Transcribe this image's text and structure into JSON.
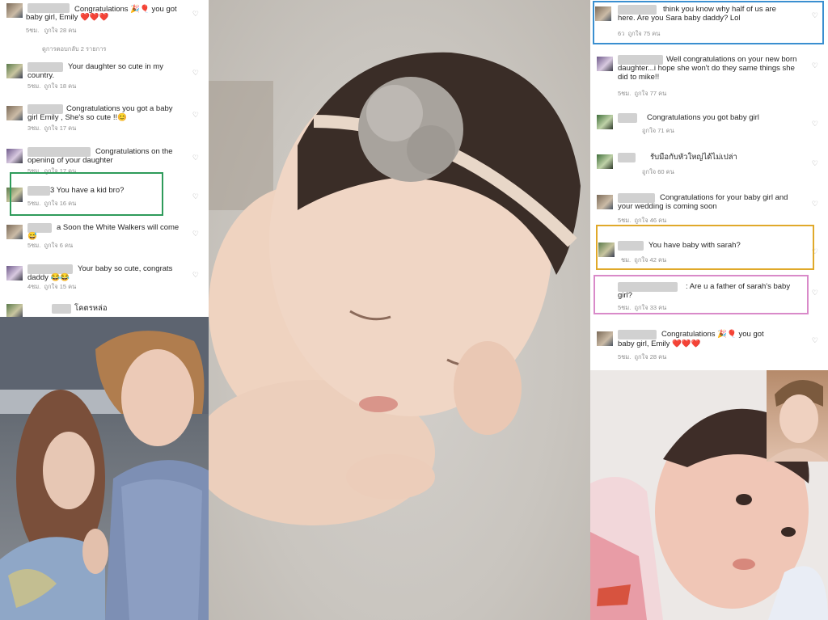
{
  "left_comments": {
    "top_text": "Congratulations",
    "top_emoji": "🎉🎈",
    "top_rest": "you got",
    "top_line2": "baby girl, Emily",
    "top_hearts": "❤️❤️❤️",
    "top_meta_time": "5ชม.",
    "top_meta_likes": "ถูกใจ 28 คน",
    "view_replies": "ดูการตอบกลับ 2 รายการ",
    "items": [
      {
        "text": "Your daughter so cute in my country.",
        "time": "5ชม.",
        "likes": "ถูกใจ 18 คน"
      },
      {
        "text": "Congratulations you got a baby girl Emily , She's so cute !!😊",
        "time": "3ชม.",
        "likes": "ถูกใจ 17 คน"
      },
      {
        "text": "Congratulations on the opening of your daughter",
        "time": "5ชม.",
        "likes": "ถูกใจ 17 คน"
      },
      {
        "text": "3 You have a kid bro?",
        "time": "5ชม.",
        "likes": "ถูกใจ 16 คน"
      },
      {
        "text": "a Soon the White Walkers will come 😅",
        "time": "5ชม.",
        "likes": "ถูกใจ 6 คน"
      },
      {
        "text": "Your baby so cute, congrats daddy 😂😂",
        "time": "4ชม.",
        "likes": "ถูกใจ 15 คน"
      },
      {
        "text": "โคตรหล่อ",
        "time": "",
        "likes": ""
      }
    ]
  },
  "right_comments": {
    "items": [
      {
        "text": "think you know why half of us are here.  Are you Sara baby daddy? Lol",
        "time": "6ว",
        "likes": "ถูกใจ 75 คน"
      },
      {
        "text": "Well congratulations on your new born daughter...i hope she won't do they same things she did to mike!!",
        "time": "5ชม.",
        "likes": "ถูกใจ 77 คน"
      },
      {
        "text": "Congratulations you got baby girl",
        "time": "",
        "likes": "ถูกใจ 71 คน"
      },
      {
        "text": "รับมือกับหัวใหญ่ได้ไม่เปล่า",
        "time": "",
        "likes": "ถูกใจ 60 คน"
      },
      {
        "text": "Congratulations for your baby girl and your wedding is coming soon",
        "time": "5ชม.",
        "likes": "ถูกใจ 46 คน"
      },
      {
        "text": "You have baby with sarah?",
        "time": "ชม.",
        "likes": "ถูกใจ 42 คน"
      },
      {
        "text": ": Are u a father of sarah's baby girl?",
        "time": "5ชม.",
        "likes": "ถูกใจ 33 คน"
      },
      {
        "text": "Congratulations",
        "emoji": "🎉🎈",
        "rest": "you got",
        "line2": "baby girl, Emily",
        "hearts": "❤️❤️❤️",
        "time": "5ชม.",
        "likes": "ถูกใจ 28 คน"
      }
    ]
  },
  "colors": {
    "highlight_green": "#2e9b5a",
    "highlight_blue": "#3a8fd0",
    "highlight_yellow": "#e0a92a",
    "highlight_pink": "#d98ac9"
  },
  "icons": {
    "like": "heart-outline-icon"
  }
}
